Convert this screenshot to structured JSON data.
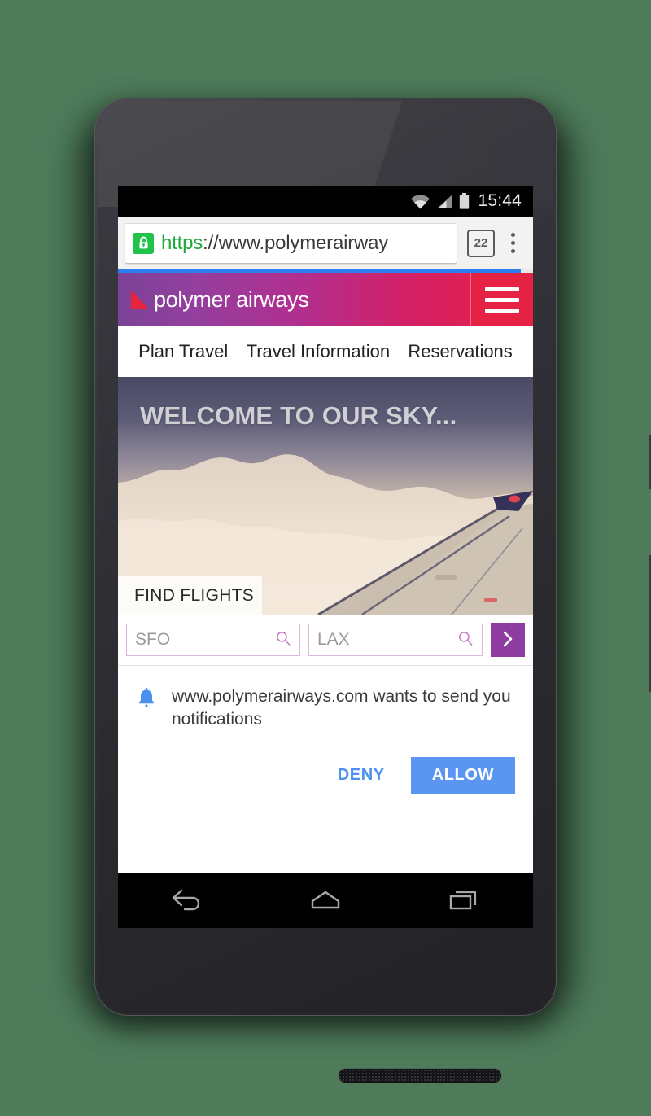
{
  "status_bar": {
    "wifi_icon": "wifi-icon",
    "signal_icon": "signal-icon",
    "battery_icon": "battery-icon",
    "clock": "15:44"
  },
  "browser": {
    "lock_icon": "lock-icon",
    "url_scheme": "https",
    "url_separator": "://",
    "url_host": "www.polymerairway",
    "url_full": "https://www.polymerairway",
    "tab_count": "22",
    "overflow_icon": "overflow-menu-icon",
    "progress_percent": 97
  },
  "site": {
    "logo_icon": "wing-logo-icon",
    "brand_name": "polymer airways",
    "menu_icon": "hamburger-icon",
    "nav_items": [
      {
        "label": "Plan Travel"
      },
      {
        "label": "Travel Information"
      },
      {
        "label": "Reservations"
      }
    ],
    "hero": {
      "title": "WELCOME TO OUR SKY...",
      "tab_label": "FIND FLIGHTS"
    },
    "search": {
      "origin_placeholder": "SFO",
      "destination_placeholder": "LAX",
      "origin_value": "",
      "destination_value": "",
      "search_icon": "magnifier-icon",
      "submit_icon": "chevron-right-icon"
    }
  },
  "permission_dialog": {
    "bell_icon": "bell-icon",
    "origin": "www.polymerairways.com",
    "message": "www.polymerairways.com wants to send you notifications",
    "deny_label": "DENY",
    "allow_label": "ALLOW"
  },
  "android_nav": {
    "back_icon": "back-arrow-icon",
    "home_icon": "home-icon",
    "recents_icon": "recents-icon"
  },
  "colors": {
    "brand_purple": "#7b4397",
    "brand_red": "#e62244",
    "accent_purple": "#8e3ca0",
    "dialog_blue": "#5b95f2",
    "lock_green": "#21c24a",
    "progress_blue": "#2d7ff0"
  }
}
